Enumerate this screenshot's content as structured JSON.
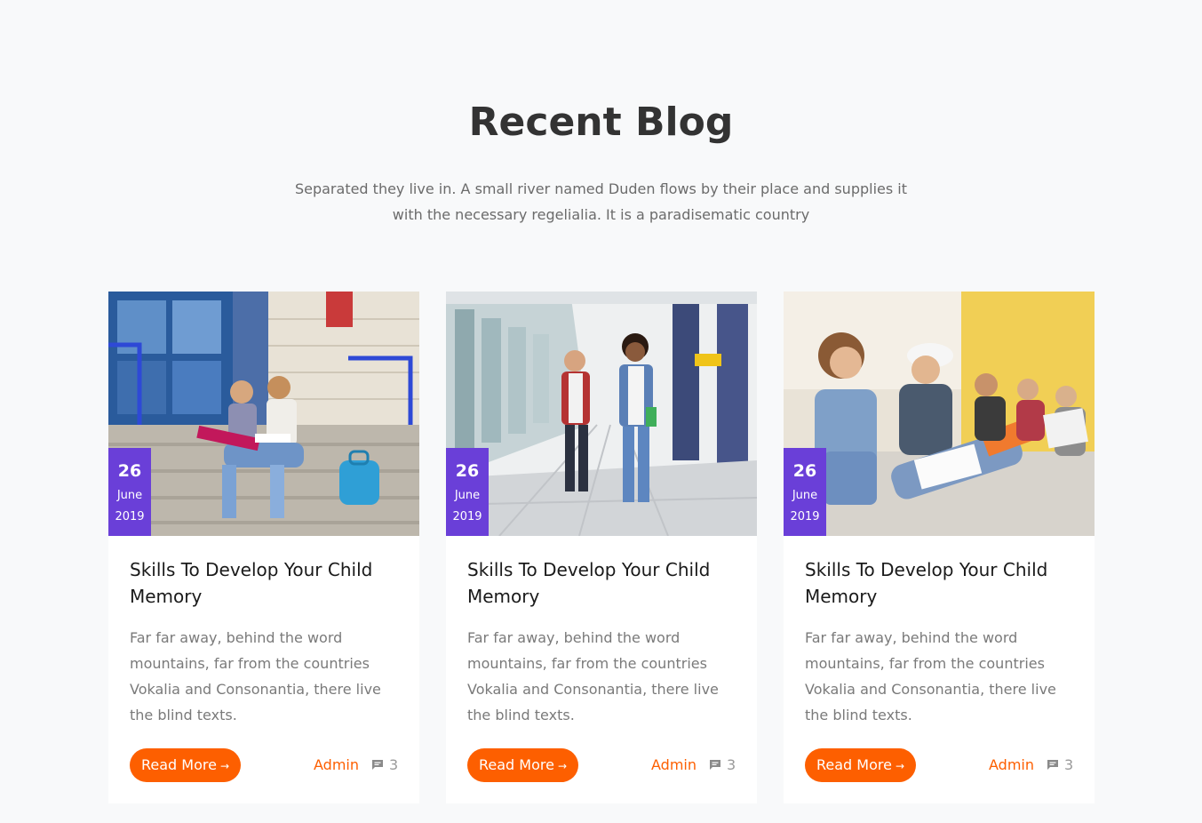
{
  "section": {
    "title": "Recent Blog",
    "subtitle": "Separated they live in. A small river named Duden flows by their place and supplies it with the necessary regelialia. It is a paradisematic country"
  },
  "colors": {
    "accent": "#fd5f00",
    "date_badge": "#6a3fd8",
    "background": "#f8f9fa"
  },
  "posts": [
    {
      "image_icon": "students-on-stairs-photo",
      "day": "26",
      "month": "June",
      "year": "2019",
      "title": "Skills To Develop Your Child Memory",
      "excerpt": "Far far away, behind the word mountains, far from the countries Vokalia and Consonantia, there live the blind texts.",
      "read_more": "Read More",
      "author": "Admin",
      "comments": "3"
    },
    {
      "image_icon": "students-walking-photo",
      "day": "26",
      "month": "June",
      "year": "2019",
      "title": "Skills To Develop Your Child Memory",
      "excerpt": "Far far away, behind the word mountains, far from the countries Vokalia and Consonantia, there live the blind texts.",
      "read_more": "Read More",
      "author": "Admin",
      "comments": "3"
    },
    {
      "image_icon": "students-studying-photo",
      "day": "26",
      "month": "June",
      "year": "2019",
      "title": "Skills To Develop Your Child Memory",
      "excerpt": "Far far away, behind the word mountains, far from the countries Vokalia and Consonantia, there live the blind texts.",
      "read_more": "Read More",
      "author": "Admin",
      "comments": "3"
    }
  ]
}
